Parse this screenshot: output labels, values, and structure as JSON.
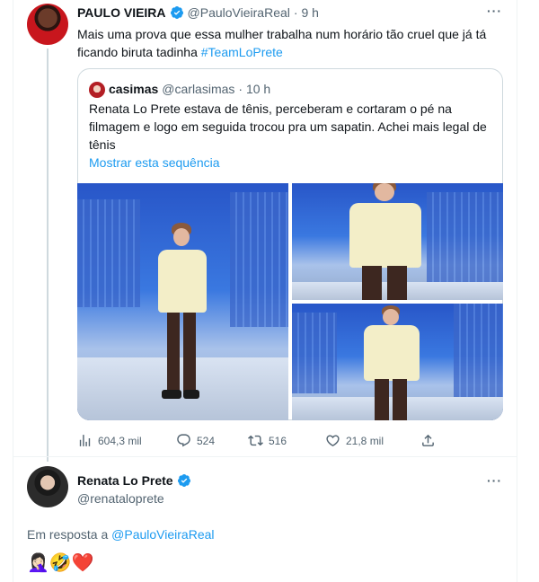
{
  "tweet1": {
    "author_name": "PAULO VIEIRA",
    "handle": "@PauloVieiraReal",
    "time": "· 9 h",
    "text_line1": "Mais uma prova que essa mulher trabalha num horário tão cruel que já tá",
    "text_line2": "ficando biruta tadinha",
    "hashtag": "#TeamLoPrete",
    "quote": {
      "author_name": "casimas",
      "handle": "@carlasimas",
      "time": "· 10 h",
      "text_line1": "Renata Lo Prete estava de tênis, perceberam e cortaram o pé na",
      "text_line2": "filmagem e logo em seguida trocou pra um sapatin. Achei mais legal de",
      "text_line3": "tênis",
      "show_thread": "Mostrar esta sequência"
    },
    "stats": {
      "views": "604,3 mil",
      "replies": "524",
      "retweets": "516",
      "likes": "21,8 mil"
    }
  },
  "tweet2": {
    "author_name": "Renata Lo Prete",
    "handle": "@renataloprete",
    "reply_prefix": "Em resposta a",
    "reply_to": "@PauloVieiraReal",
    "emojis": "🤦🏻‍♀️🤣❤️"
  },
  "colors": {
    "accent": "#1d9bf0",
    "muted": "#536471",
    "text": "#0f1419"
  },
  "icons": [
    "verified-badge-icon",
    "more-icon",
    "views-icon",
    "reply-icon",
    "retweet-icon",
    "like-icon",
    "share-icon"
  ]
}
